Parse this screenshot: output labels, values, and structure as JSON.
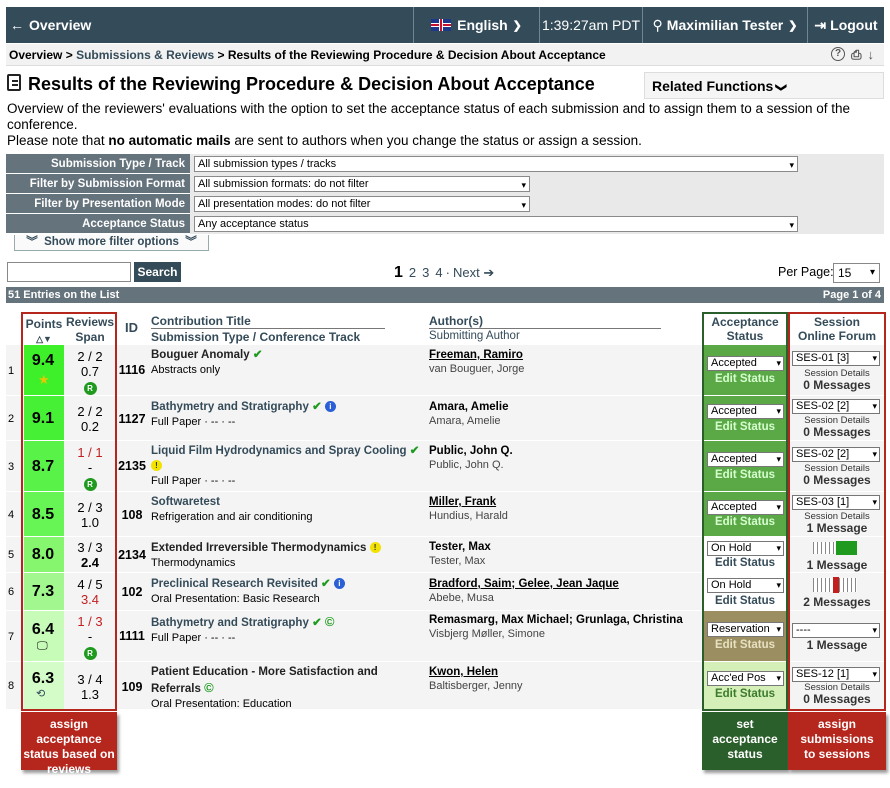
{
  "nav": {
    "overview": "Overview",
    "language": "English",
    "time": "1:39:27am PDT",
    "user": "Maximilian Tester",
    "logout": "Logout"
  },
  "breadcrumb": {
    "overview": "Overview",
    "sep1": ">",
    "submissions": "Submissions & Reviews",
    "sep2": ">",
    "current": "Results of the Reviewing Procedure & Decision About Acceptance"
  },
  "page": {
    "title": "Results of the Reviewing Procedure & Decision About Acceptance",
    "related": "Related Functions",
    "desc1": "Overview of the reviewers' evaluations with the option to set the acceptance status of each submission and to assign them to a session of the conference.",
    "desc2a": "Please note that ",
    "desc2b": "no automatic mails",
    "desc2c": " are sent to authors when you change the status or assign a session."
  },
  "filters": [
    {
      "label": "Submission Type / Track",
      "value": "All submission types / tracks"
    },
    {
      "label": "Filter by Submission Format",
      "value": "All submission formats: do not filter"
    },
    {
      "label": "Filter by Presentation Mode",
      "value": "All presentation modes: do not filter"
    },
    {
      "label": "Acceptance Status",
      "value": "Any acceptance status"
    }
  ],
  "show_more": "Show more filter options",
  "search": {
    "button": "Search",
    "placeholder": ""
  },
  "pager": {
    "p1": "1",
    "p2": "2",
    "p3": "3",
    "p4": "4",
    "dot": "·",
    "next": "Next"
  },
  "per_page": {
    "label": "Per Page:",
    "value": "15"
  },
  "entries": {
    "count": "51 Entries on the List",
    "page": "Page 1 of 4"
  },
  "headers": {
    "points": "Points",
    "reviews": "Reviews",
    "span": "Span",
    "id": "ID",
    "title": "Contribution Title",
    "type": "Submission Type / Conference Track",
    "authors": "Author(s)",
    "submitting": "Submitting Author",
    "acc1": "Acceptance",
    "acc2": "Status",
    "ses1": "Session",
    "ses2": "Online Forum"
  },
  "rows": [
    {
      "n": "1",
      "points": "9.4",
      "reviews": "2 / 2",
      "span": "0.7",
      "id": "1116",
      "title": "Bouguer Anomaly",
      "type": "Abstracts only",
      "authors": "Freeman, Ramiro",
      "sub": "van Bouguer, Jorge",
      "status": "Accepted",
      "edit": "Edit Status",
      "session": "SES-01 [3]",
      "details": "Session Details",
      "messages": "0 Messages"
    },
    {
      "n": "2",
      "points": "9.1",
      "reviews": "2 / 2",
      "span": "0.2",
      "id": "1127",
      "title": "Bathymetry and Stratigraphy",
      "type": "Full Paper · -- · --",
      "authors": "Amara, Amelie",
      "sub": "Amara, Amelie",
      "status": "Accepted",
      "edit": "Edit Status",
      "session": "SES-02 [2]",
      "details": "Session Details",
      "messages": "0 Messages"
    },
    {
      "n": "3",
      "points": "8.7",
      "reviews": "1 / 1",
      "span": "-",
      "id": "2135",
      "title": "Liquid Film Hydrodynamics and Spray Cooling",
      "type": "Full Paper · -- · --",
      "authors": "Public, John Q.",
      "sub": "Public, John Q.",
      "status": "Accepted",
      "edit": "Edit Status",
      "session": "SES-02 [2]",
      "details": "Session Details",
      "messages": "0 Messages"
    },
    {
      "n": "4",
      "points": "8.5",
      "reviews": "2 / 3",
      "span": "1.0",
      "id": "108",
      "title": "Softwaretest",
      "type": "Refrigeration and air conditioning",
      "authors": "Miller, Frank",
      "sub": "Hundius, Harald",
      "status": "Accepted",
      "edit": "Edit Status",
      "session": "SES-03 [1]",
      "details": "Session Details",
      "messages": "1 Message"
    },
    {
      "n": "5",
      "points": "8.0",
      "reviews": "3 / 3",
      "span": "2.4",
      "id": "2134",
      "title": "Extended Irreversible Thermodynamics",
      "type": "Thermodynamics",
      "authors": "Tester, Max",
      "sub": "Tester, Max",
      "status": "On Hold",
      "edit": "Edit Status",
      "session": "",
      "details": "",
      "messages": "1 Message"
    },
    {
      "n": "6",
      "points": "7.3",
      "reviews": "4 / 5",
      "span": "3.4",
      "id": "102",
      "title": "Preclinical Research Revisited",
      "type": "Oral Presentation: Basic Research",
      "authors": "Bradford, Saim; Gelee, Jean Jaque",
      "sub": "Abebe, Musa",
      "status": "On Hold",
      "edit": "Edit Status",
      "session": "",
      "details": "",
      "messages": "2 Messages"
    },
    {
      "n": "7",
      "points": "6.4",
      "reviews": "1 / 3",
      "span": "-",
      "id": "1111",
      "title": "Bathymetry and Stratigraphy",
      "type": "Full Paper · -- · --",
      "authors": "Remasmarg, Max Michael; Grunlaga, Christina",
      "sub": "Visbjerg Møller, Simone",
      "status": "Reservation",
      "edit": "Edit Status",
      "session": "----",
      "details": "",
      "messages": "1 Message"
    },
    {
      "n": "8",
      "points": "6.3",
      "reviews": "3 / 4",
      "span": "1.3",
      "id": "109",
      "title": "Patient Education - More Satisfaction and Referrals",
      "type": "Oral Presentation: Education",
      "authors": "Kwon, Helen",
      "sub": "Baltisberger, Jenny",
      "status": "Acc'ed Pos",
      "edit": "Edit Status",
      "session": "SES-12 [1]",
      "details": "Session Details",
      "messages": "0 Messages"
    }
  ],
  "callouts": {
    "reviews": "assign acceptance status based on reviews",
    "status": "set acceptance status",
    "sessions": "assign submissions to sessions"
  },
  "colors": {
    "nav": "#344b59",
    "accepted": "#5aa846",
    "onhold": "#ffffff",
    "reservation": "#9b8f62",
    "accpos": "#d4f0b8",
    "callout_red": "#b5261d",
    "callout_green": "#2a5e2a"
  }
}
